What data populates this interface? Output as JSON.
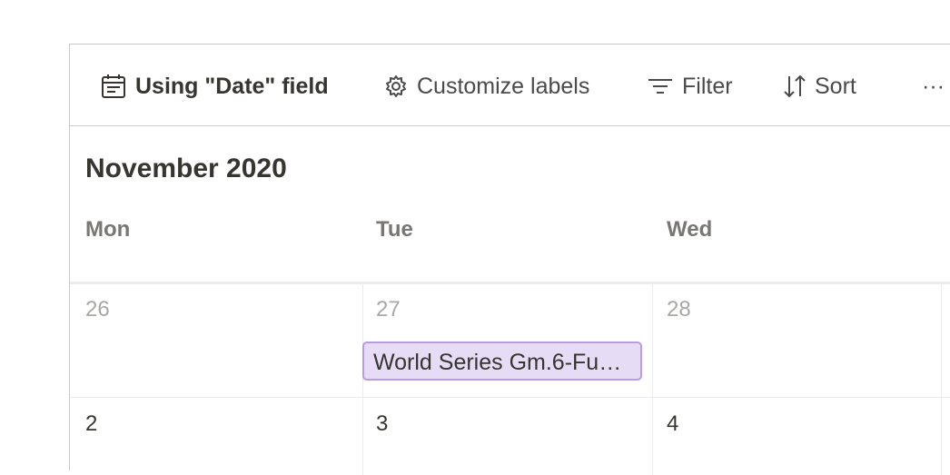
{
  "toolbar": {
    "date_field_label": "Using \"Date\" field",
    "customize_labels": "Customize labels",
    "filter_label": "Filter",
    "sort_label": "Sort",
    "more_label": "···"
  },
  "calendar": {
    "month_title": "November 2020",
    "weekdays": [
      "Mon",
      "Tue",
      "Wed"
    ],
    "weeks": [
      {
        "days": [
          "26",
          "27",
          "28"
        ]
      },
      {
        "days": [
          "2",
          "3",
          "4"
        ]
      }
    ],
    "events": [
      {
        "title": "World Series Gm.6-Fu…",
        "color": "#e7dcf6",
        "border": "#b99be6"
      }
    ]
  }
}
